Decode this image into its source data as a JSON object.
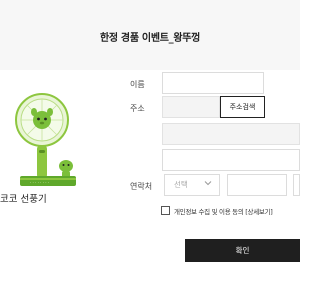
{
  "header": {
    "title": "한정 경품 이벤트_왕뚜껑"
  },
  "product": {
    "name": "코코 선풍기",
    "image_icon": "handheld-fan-icon"
  },
  "form": {
    "name_label": "이름",
    "address_label": "주소",
    "address_search_button": "주소검색",
    "contact_label": "연락처",
    "contact_select_value": "선택",
    "agree_text": "개인정보 수집 및 이용 동의 [상세보기]",
    "confirm_button": "확인"
  },
  "colors": {
    "primary_button": "#1f1f1f",
    "fan_green": "#8dc63f",
    "header_bg": "#f7f7f7"
  }
}
